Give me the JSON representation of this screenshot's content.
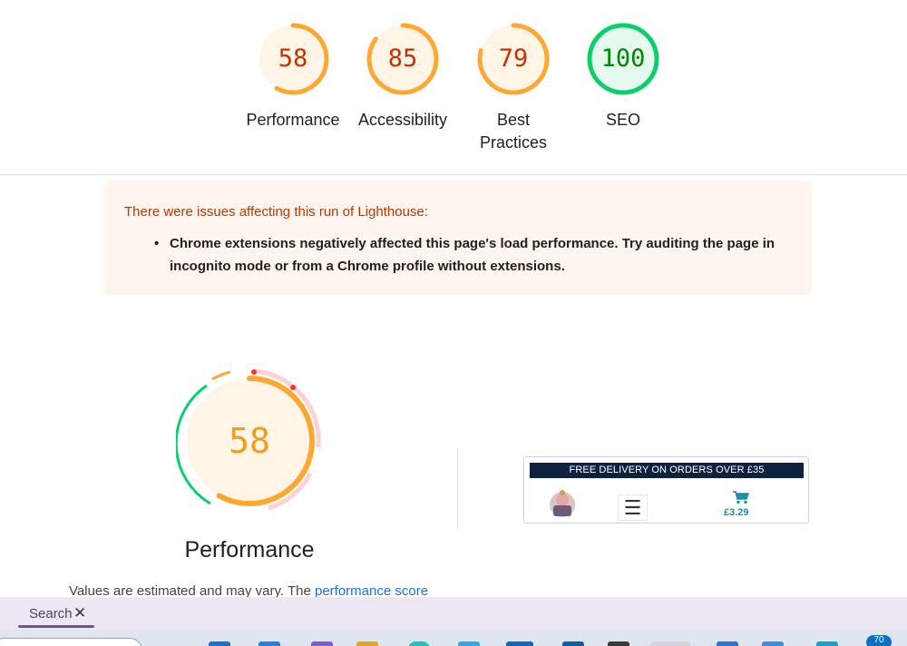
{
  "scores": [
    {
      "label": "Performance",
      "value": 58,
      "rating": "average",
      "color": "#fea733",
      "bg": "#fff5e6",
      "text_color": "#c33300"
    },
    {
      "label": "Accessibility",
      "value": 85,
      "rating": "average",
      "color": "#fea733",
      "bg": "#fff5e6",
      "text_color": "#c33300"
    },
    {
      "label": "Best Practices",
      "value": 79,
      "rating": "average",
      "color": "#fea733",
      "bg": "#fff5e6",
      "text_color": "#c33300"
    },
    {
      "label": "SEO",
      "value": 100,
      "rating": "pass",
      "color": "#0cce6b",
      "bg": "#e6f9ef",
      "text_color": "#008800"
    }
  ],
  "warning": {
    "title": "There were issues affecting this run of Lighthouse:",
    "items": [
      "Chrome extensions negatively affected this page's load performance. Try auditing the page in incognito mode or from a Chrome profile without extensions."
    ]
  },
  "performance": {
    "score": 58,
    "title": "Performance",
    "note_text": "Values are estimated and may vary. The",
    "note_link": "performance score"
  },
  "thumbnail": {
    "banner": "FREE DELIVERY ON ORDERS OVER £35",
    "menu_icon": "☰",
    "price": "£3.29"
  },
  "search_tab": {
    "label": "Search",
    "close": "✕"
  },
  "taskbar": {
    "badge": "70"
  }
}
